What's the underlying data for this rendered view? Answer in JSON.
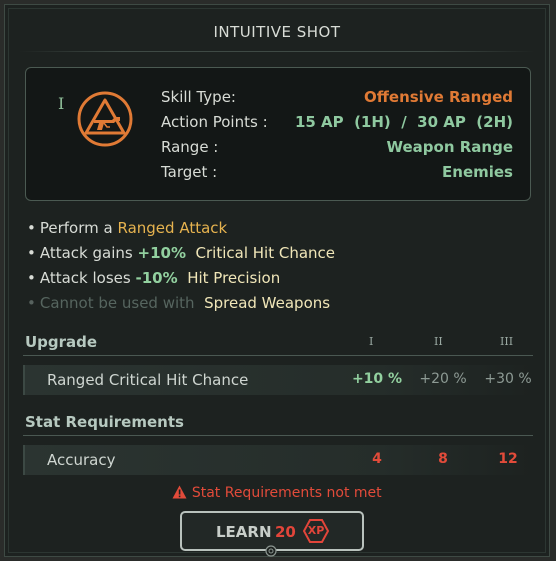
{
  "title": "INTUITIVE SHOT",
  "skill": {
    "tier": "I",
    "icon": "ranged-weapon-hazard-icon",
    "stats": [
      {
        "label": "Skill Type:",
        "value": "Offensive Ranged",
        "color": "#e07a35"
      },
      {
        "label": "Action Points :",
        "value": "15 AP  (1H)  /  30 AP  (2H)",
        "color": "#8fc9a0"
      },
      {
        "label": "Range :",
        "value": "Weapon Range",
        "color": "#8fc9a0"
      },
      {
        "label": "Target :",
        "value": "Enemies",
        "color": "#8fc9a0"
      }
    ]
  },
  "effects": [
    {
      "prefix": "Perform a",
      "highlight": "Ranged Attack"
    },
    {
      "prefix": "Attack gains",
      "amount": "+10%",
      "highlight": "Critical Hit Chance"
    },
    {
      "prefix": "Attack loses",
      "amount": "-10%",
      "highlight": "Hit Precision"
    },
    {
      "prefix": "Cannot be used with",
      "highlight": "Spread Weapons"
    }
  ],
  "upgrade": {
    "heading": "Upgrade",
    "tiers": [
      "I",
      "II",
      "III"
    ],
    "row": {
      "label": "Ranged Critical Hit Chance",
      "values": [
        "+10 %",
        "+20 %",
        "+30 %"
      ]
    }
  },
  "requirements": {
    "heading": "Stat Requirements",
    "row": {
      "label": "Accuracy",
      "values": [
        "4",
        "8",
        "12"
      ]
    },
    "warning": "Stat Requirements not met"
  },
  "learn": {
    "label": "LEARN",
    "cost": "20",
    "unit": "XP"
  },
  "colors": {
    "accent_orange": "#e07a35",
    "accent_green": "#8fc9a0",
    "warning_red": "#e24b3a",
    "highlight_yellow": "#e6b34f"
  }
}
